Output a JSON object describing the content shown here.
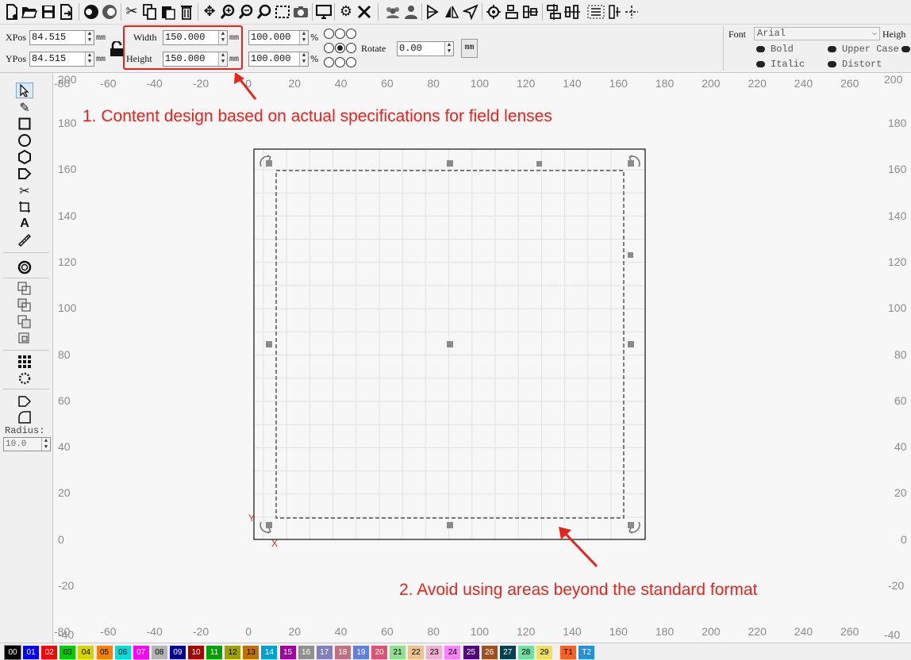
{
  "toolbar": {
    "icons": [
      "new-file",
      "open-folder",
      "save",
      "export",
      "circle-dark",
      "circle-half",
      "cut",
      "copy",
      "paste",
      "delete",
      "move",
      "zoom-in",
      "zoom-out",
      "zoom-window",
      "select-rect",
      "camera",
      "monitor",
      "settings",
      "tools",
      "group-users",
      "user",
      "mirror-h",
      "mirror-v",
      "send",
      "target",
      "align-a",
      "align-b",
      "distribute-a",
      "distribute-b",
      "node-edit"
    ]
  },
  "props": {
    "xpos_label": "XPos",
    "xpos_value": "84.515",
    "ypos_label": "YPos",
    "ypos_value": "84.515",
    "width_label": "Width",
    "width_value": "150.000",
    "height_label": "Height",
    "height_value": "150.000",
    "unit": "mm",
    "scale_x": "100.000",
    "scale_y": "100.000",
    "percent": "%",
    "rotate_label": "Rotate",
    "rotate_value": "0.00",
    "mm_button": "mm",
    "font_label": "Font",
    "font_value": "Arial",
    "font_height_label": "Heigh",
    "bold": "Bold",
    "italic": "Italic",
    "upper_case": "Upper Case",
    "distort": "Distort"
  },
  "toolbox": {
    "radius_label": "Radius:",
    "radius_value": "10.0"
  },
  "ruler": {
    "top_labels": [
      "-80",
      "-60",
      "-40",
      "-20",
      "0",
      "20",
      "40",
      "60",
      "80",
      "100",
      "120",
      "140",
      "160",
      "180",
      "200",
      "220",
      "240",
      "260"
    ],
    "bottom_labels": [
      "-80",
      "-60",
      "-40",
      "-20",
      "0",
      "20",
      "40",
      "60",
      "80",
      "100",
      "120",
      "140",
      "160",
      "180",
      "200",
      "220",
      "240",
      "260"
    ],
    "left_labels": [
      "180",
      "160",
      "140",
      "120",
      "100",
      "80",
      "60",
      "40",
      "20",
      "0",
      "-20"
    ],
    "right_labels": [
      "180",
      "160",
      "140",
      "120",
      "100",
      "80",
      "60",
      "40",
      "20",
      "0",
      "-20"
    ],
    "corner_top_left": "200",
    "corner_top_right": "200",
    "corner_bottom_left": "-40",
    "corner_bottom_right": "-40"
  },
  "canvas": {
    "y_axis_label": "Y",
    "x_axis_label": "X"
  },
  "annotations": {
    "note1": "1. Content design based on actual specifications for field lenses",
    "note2": "2. Avoid using areas beyond the standard format"
  },
  "colors": {
    "annotation": "#e8231b",
    "highlight_box": "#e8231b"
  },
  "palette": [
    {
      "label": "00",
      "bg": "#000000",
      "fg": "#ffffff"
    },
    {
      "label": "01",
      "bg": "#0000ff",
      "fg": "#ffffff"
    },
    {
      "label": "02",
      "bg": "#ff0000",
      "fg": "#ffffff"
    },
    {
      "label": "03",
      "bg": "#00cc00",
      "fg": "#000000"
    },
    {
      "label": "04",
      "bg": "#d4d400",
      "fg": "#000000"
    },
    {
      "label": "05",
      "bg": "#ff8000",
      "fg": "#000000"
    },
    {
      "label": "06",
      "bg": "#00dcdc",
      "fg": "#000000"
    },
    {
      "label": "07",
      "bg": "#ff00ff",
      "fg": "#ffffff"
    },
    {
      "label": "08",
      "bg": "#b4b4b4",
      "fg": "#000000"
    },
    {
      "label": "09",
      "bg": "#000096",
      "fg": "#ffffff"
    },
    {
      "label": "10",
      "bg": "#aa0000",
      "fg": "#ffffff"
    },
    {
      "label": "11",
      "bg": "#00a000",
      "fg": "#ffffff"
    },
    {
      "label": "12",
      "bg": "#a0a000",
      "fg": "#000000"
    },
    {
      "label": "13",
      "bg": "#c07000",
      "fg": "#000000"
    },
    {
      "label": "14",
      "bg": "#00a0d0",
      "fg": "#ffffff"
    },
    {
      "label": "15",
      "bg": "#a000a0",
      "fg": "#ffffff"
    },
    {
      "label": "16",
      "bg": "#909090",
      "fg": "#ffffff"
    },
    {
      "label": "17",
      "bg": "#8080c0",
      "fg": "#ffffff"
    },
    {
      "label": "18",
      "bg": "#c07080",
      "fg": "#ffffff"
    },
    {
      "label": "19",
      "bg": "#6080e0",
      "fg": "#ffffff"
    },
    {
      "label": "20",
      "bg": "#e05070",
      "fg": "#ffffff"
    },
    {
      "label": "21",
      "bg": "#90e090",
      "fg": "#000000"
    },
    {
      "label": "22",
      "bg": "#f0c090",
      "fg": "#000000"
    },
    {
      "label": "23",
      "bg": "#f0b0d0",
      "fg": "#000000"
    },
    {
      "label": "24",
      "bg": "#ff80ff",
      "fg": "#000000"
    },
    {
      "label": "25",
      "bg": "#500080",
      "fg": "#ffffff"
    },
    {
      "label": "26",
      "bg": "#a05020",
      "fg": "#ffffff"
    },
    {
      "label": "27",
      "bg": "#004050",
      "fg": "#ffffff"
    },
    {
      "label": "28",
      "bg": "#70e0a0",
      "fg": "#000000"
    },
    {
      "label": "29",
      "bg": "#f0e060",
      "fg": "#000000"
    },
    {
      "label": "T1",
      "bg": "#ff6020",
      "fg": "#000000"
    },
    {
      "label": "T2",
      "bg": "#2090e0",
      "fg": "#ffffff"
    }
  ]
}
